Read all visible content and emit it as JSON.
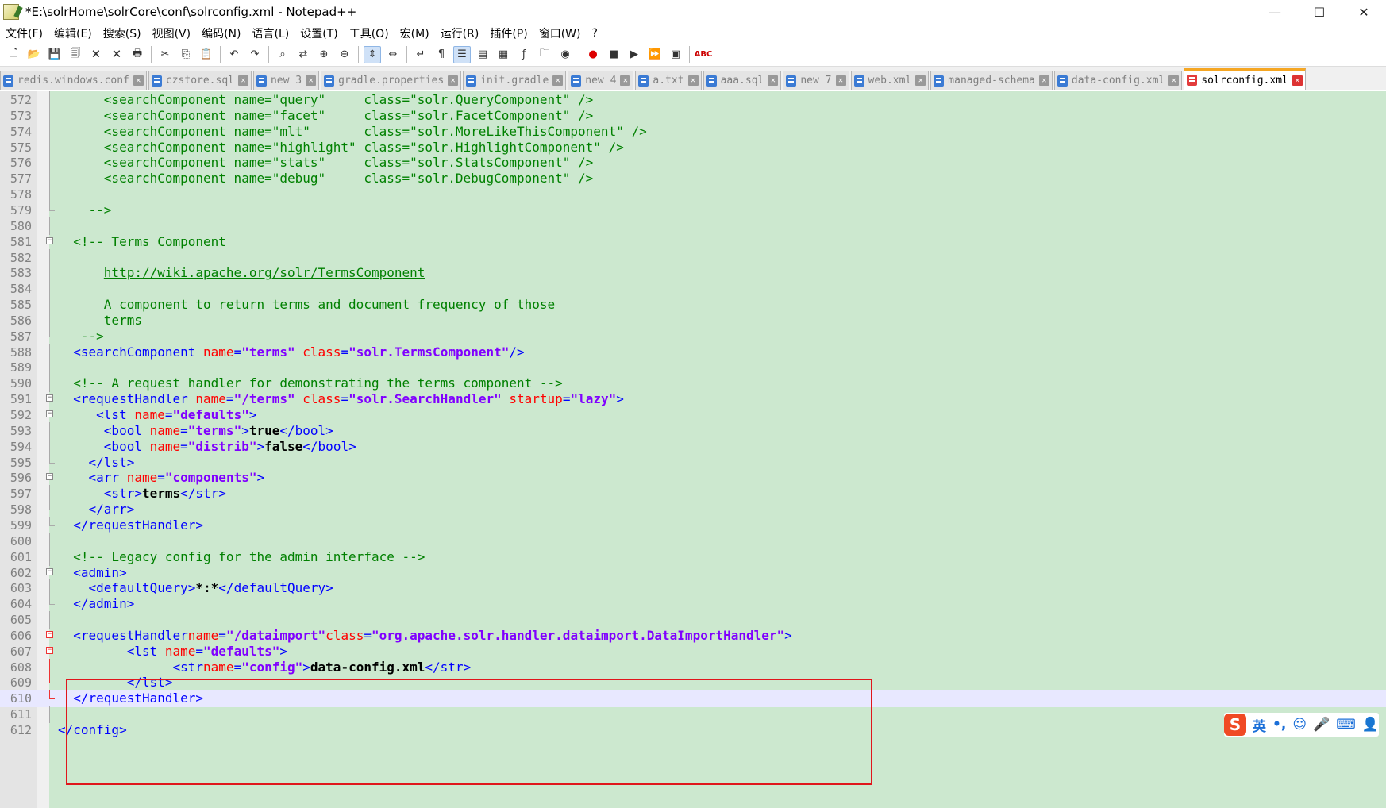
{
  "window": {
    "title": "*E:\\solrHome\\solrCore\\conf\\solrconfig.xml - Notepad++",
    "minimize": "—",
    "maximize": "☐",
    "close": "✕"
  },
  "menu": [
    "文件(F)",
    "编辑(E)",
    "搜索(S)",
    "视图(V)",
    "编码(N)",
    "语言(L)",
    "设置(T)",
    "工具(O)",
    "宏(M)",
    "运行(R)",
    "插件(P)",
    "窗口(W)",
    "?"
  ],
  "toolbar": {
    "icons": [
      "new-file-icon",
      "open-file-icon",
      "save-icon",
      "save-all-icon",
      "close-icon",
      "close-all-icon",
      "print-icon",
      "cut-icon",
      "copy-icon",
      "paste-icon",
      "undo-icon",
      "redo-icon",
      "find-icon",
      "replace-icon",
      "zoom-in-icon",
      "zoom-out-icon",
      "sync-v-icon",
      "sync-h-icon",
      "wrap-icon",
      "show-all-chars-icon",
      "indent-guide-icon",
      "lang-icon",
      "doc-map-icon",
      "function-list-icon",
      "folder-icon",
      "monitor-icon",
      "record-macro-icon",
      "stop-record-icon",
      "play-macro-icon",
      "run-macro-multi-icon",
      "save-macro-icon",
      "spellcheck-icon"
    ],
    "spellcheck_label": "ABC"
  },
  "tabs": [
    {
      "label": "redis.windows.conf",
      "active": false
    },
    {
      "label": "czstore.sql",
      "active": false
    },
    {
      "label": "new 3",
      "active": false
    },
    {
      "label": "gradle.properties",
      "active": false
    },
    {
      "label": "init.gradle",
      "active": false
    },
    {
      "label": "new 4",
      "active": false
    },
    {
      "label": "a.txt",
      "active": false
    },
    {
      "label": "aaa.sql",
      "active": false
    },
    {
      "label": "new 7",
      "active": false
    },
    {
      "label": "web.xml",
      "active": false
    },
    {
      "label": "managed-schema",
      "active": false
    },
    {
      "label": "data-config.xml",
      "active": false
    },
    {
      "label": "solrconfig.xml",
      "active": true
    }
  ],
  "editor": {
    "lines": [
      {
        "n": "572",
        "fold": "line",
        "segs": [
          [
            "cm",
            "      <searchComponent name=\"query\"     class=\"solr.QueryComponent\" />"
          ]
        ]
      },
      {
        "n": "573",
        "fold": "line",
        "segs": [
          [
            "cm",
            "      <searchComponent name=\"facet\"     class=\"solr.FacetComponent\" />"
          ]
        ]
      },
      {
        "n": "574",
        "fold": "line",
        "segs": [
          [
            "cm",
            "      <searchComponent name=\"mlt\"       class=\"solr.MoreLikeThisComponent\" />"
          ]
        ]
      },
      {
        "n": "575",
        "fold": "line",
        "segs": [
          [
            "cm",
            "      <searchComponent name=\"highlight\" class=\"solr.HighlightComponent\" />"
          ]
        ]
      },
      {
        "n": "576",
        "fold": "line",
        "segs": [
          [
            "cm",
            "      <searchComponent name=\"stats\"     class=\"solr.StatsComponent\" />"
          ]
        ]
      },
      {
        "n": "577",
        "fold": "line",
        "segs": [
          [
            "cm",
            "      <searchComponent name=\"debug\"     class=\"solr.DebugComponent\" />"
          ]
        ]
      },
      {
        "n": "578",
        "fold": "line",
        "segs": []
      },
      {
        "n": "579",
        "fold": "end",
        "segs": [
          [
            "cm",
            "    -->"
          ]
        ]
      },
      {
        "n": "580",
        "fold": "line",
        "segs": []
      },
      {
        "n": "581",
        "fold": "box",
        "segs": [
          [
            "cm",
            "  <!-- Terms Component"
          ]
        ]
      },
      {
        "n": "582",
        "fold": "line",
        "segs": []
      },
      {
        "n": "583",
        "fold": "line",
        "segs": [
          [
            "cm",
            "      "
          ],
          [
            "ln",
            "http://wiki.apache.org/solr/TermsComponent"
          ]
        ]
      },
      {
        "n": "584",
        "fold": "line",
        "segs": []
      },
      {
        "n": "585",
        "fold": "line",
        "segs": [
          [
            "cm",
            "      A component to return terms and document frequency of those"
          ]
        ]
      },
      {
        "n": "586",
        "fold": "line",
        "segs": [
          [
            "cm",
            "      terms"
          ]
        ]
      },
      {
        "n": "587",
        "fold": "end",
        "segs": [
          [
            "cm",
            "   -->"
          ]
        ]
      },
      {
        "n": "588",
        "fold": "line",
        "segs": [
          [
            "tg",
            "  <searchComponent "
          ],
          [
            "an",
            "name"
          ],
          [
            "tg",
            "="
          ],
          [
            "av",
            "\"terms\""
          ],
          [
            "tg",
            " "
          ],
          [
            "an",
            "class"
          ],
          [
            "tg",
            "="
          ],
          [
            "av",
            "\"solr.TermsComponent\""
          ],
          [
            "tg",
            "/>"
          ]
        ]
      },
      {
        "n": "589",
        "fold": "line",
        "segs": []
      },
      {
        "n": "590",
        "fold": "line",
        "segs": [
          [
            "cm",
            "  <!-- A request handler for demonstrating the terms component -->"
          ]
        ]
      },
      {
        "n": "591",
        "fold": "box",
        "segs": [
          [
            "tg",
            "  <requestHandler "
          ],
          [
            "an",
            "name"
          ],
          [
            "tg",
            "="
          ],
          [
            "av",
            "\"/terms\""
          ],
          [
            "tg",
            " "
          ],
          [
            "an",
            "class"
          ],
          [
            "tg",
            "="
          ],
          [
            "av",
            "\"solr.SearchHandler\""
          ],
          [
            "tg",
            " "
          ],
          [
            "an",
            "startup"
          ],
          [
            "tg",
            "="
          ],
          [
            "av",
            "\"lazy\""
          ],
          [
            "tg",
            ">"
          ]
        ]
      },
      {
        "n": "592",
        "fold": "box",
        "segs": [
          [
            "tg",
            "     <lst "
          ],
          [
            "an",
            "name"
          ],
          [
            "tg",
            "="
          ],
          [
            "av",
            "\"defaults\""
          ],
          [
            "tg",
            ">"
          ]
        ]
      },
      {
        "n": "593",
        "fold": "line",
        "segs": [
          [
            "tg",
            "      <bool "
          ],
          [
            "an",
            "name"
          ],
          [
            "tg",
            "="
          ],
          [
            "av",
            "\"terms\""
          ],
          [
            "tg",
            ">"
          ],
          [
            "tx",
            "true"
          ],
          [
            "tg",
            "</bool>"
          ]
        ]
      },
      {
        "n": "594",
        "fold": "line",
        "segs": [
          [
            "tg",
            "      <bool "
          ],
          [
            "an",
            "name"
          ],
          [
            "tg",
            "="
          ],
          [
            "av",
            "\"distrib\""
          ],
          [
            "tg",
            ">"
          ],
          [
            "tx",
            "false"
          ],
          [
            "tg",
            "</bool>"
          ]
        ]
      },
      {
        "n": "595",
        "fold": "end",
        "segs": [
          [
            "tg",
            "    </lst>"
          ]
        ]
      },
      {
        "n": "596",
        "fold": "box",
        "segs": [
          [
            "tg",
            "    <arr "
          ],
          [
            "an",
            "name"
          ],
          [
            "tg",
            "="
          ],
          [
            "av",
            "\"components\""
          ],
          [
            "tg",
            ">"
          ]
        ]
      },
      {
        "n": "597",
        "fold": "line",
        "segs": [
          [
            "tg",
            "      <str>"
          ],
          [
            "tx",
            "terms"
          ],
          [
            "tg",
            "</str>"
          ]
        ]
      },
      {
        "n": "598",
        "fold": "end",
        "segs": [
          [
            "tg",
            "    </arr>"
          ]
        ]
      },
      {
        "n": "599",
        "fold": "end",
        "segs": [
          [
            "tg",
            "  </requestHandler>"
          ]
        ]
      },
      {
        "n": "600",
        "fold": "line",
        "segs": []
      },
      {
        "n": "601",
        "fold": "line",
        "segs": [
          [
            "cm",
            "  <!-- Legacy config for the admin interface -->"
          ]
        ]
      },
      {
        "n": "602",
        "fold": "box",
        "segs": [
          [
            "tg",
            "  <admin>"
          ]
        ]
      },
      {
        "n": "603",
        "fold": "line",
        "segs": [
          [
            "tg",
            "    <defaultQuery>"
          ],
          [
            "tx",
            "*:*"
          ],
          [
            "tg",
            "</defaultQuery>"
          ]
        ]
      },
      {
        "n": "604",
        "fold": "end",
        "segs": [
          [
            "tg",
            "  </admin>"
          ]
        ]
      },
      {
        "n": "605",
        "fold": "line",
        "segs": []
      },
      {
        "n": "606",
        "fold": "boxred",
        "segs": [
          [
            "tg",
            "  <requestHandler"
          ],
          [
            "an",
            "name"
          ],
          [
            "tg",
            "="
          ],
          [
            "av",
            "\"/dataimport\""
          ],
          [
            "an",
            "class"
          ],
          [
            "tg",
            "="
          ],
          [
            "av",
            "\"org.apache.solr.handler.dataimport.DataImportHandler\""
          ],
          [
            "tg",
            ">"
          ]
        ]
      },
      {
        "n": "607",
        "fold": "boxred",
        "segs": [
          [
            "tg",
            "         <lst "
          ],
          [
            "an",
            "name"
          ],
          [
            "tg",
            "="
          ],
          [
            "av",
            "\"defaults\""
          ],
          [
            "tg",
            ">"
          ]
        ]
      },
      {
        "n": "608",
        "fold": "linered",
        "segs": [
          [
            "tg",
            "               <str"
          ],
          [
            "an",
            "name"
          ],
          [
            "tg",
            "="
          ],
          [
            "av",
            "\"config\""
          ],
          [
            "tg",
            ">"
          ],
          [
            "tx",
            "data-config.xml"
          ],
          [
            "tg",
            "</str>"
          ]
        ]
      },
      {
        "n": "609",
        "fold": "endred",
        "segs": [
          [
            "tg",
            "         </lst>"
          ]
        ]
      },
      {
        "n": "610",
        "fold": "endred",
        "current": true,
        "segs": [
          [
            "tg",
            "  </requestHandler>"
          ]
        ]
      },
      {
        "n": "611",
        "fold": "line",
        "segs": []
      },
      {
        "n": "612",
        "fold": "none",
        "segs": [
          [
            "tg",
            "</config>"
          ]
        ]
      }
    ]
  },
  "ime": {
    "logo": "S",
    "lang": "英",
    "punct": "•,",
    "emoji": "☺",
    "mic": "🎤",
    "keyboard": "⌨",
    "user": "👤"
  }
}
